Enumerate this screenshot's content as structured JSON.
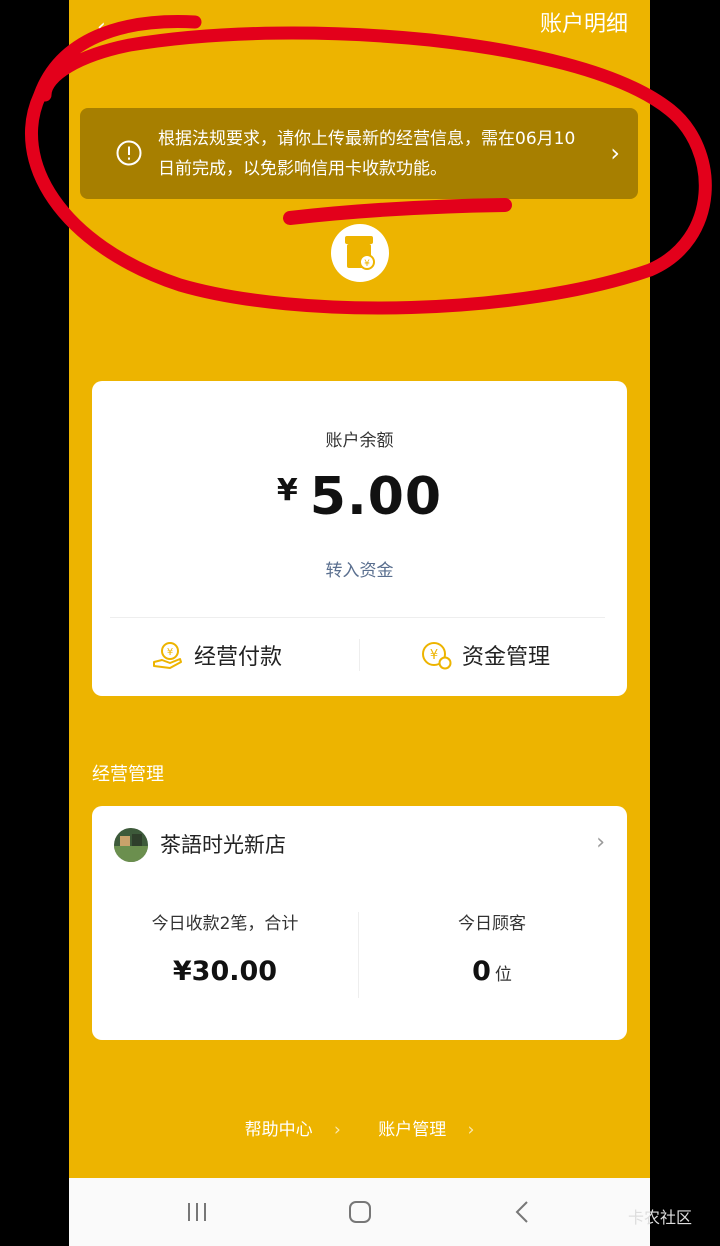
{
  "header": {
    "back_icon": "back-arrow-icon",
    "detail_label": "账户明细"
  },
  "notice": {
    "text": "根据法规要求，请你上传最新的经营信息，需在06月10日前完成，以免影响信用卡收款功能。",
    "icon": "warning-circle-icon"
  },
  "balance": {
    "label": "账户余额",
    "currency": "¥",
    "amount": "5.00",
    "transfer_label": "转入资金",
    "actions": [
      {
        "label": "经营付款",
        "icon": "payment-hand-icon"
      },
      {
        "label": "资金管理",
        "icon": "fund-management-icon"
      }
    ]
  },
  "business": {
    "section_title": "经营管理",
    "store_name": "茶語时光新店",
    "today_income_label": "今日收款2笔，合计",
    "today_income_value": "¥30.00",
    "today_customers_label": "今日顾客",
    "today_customers_value": "0",
    "today_customers_unit": "位"
  },
  "footer": {
    "help_label": "帮助中心",
    "account_label": "账户管理"
  },
  "watermark": "卡农社区",
  "colors": {
    "background": "#EDB400",
    "notice_bg": "#A77F00",
    "annotation_red": "#E3001B"
  }
}
